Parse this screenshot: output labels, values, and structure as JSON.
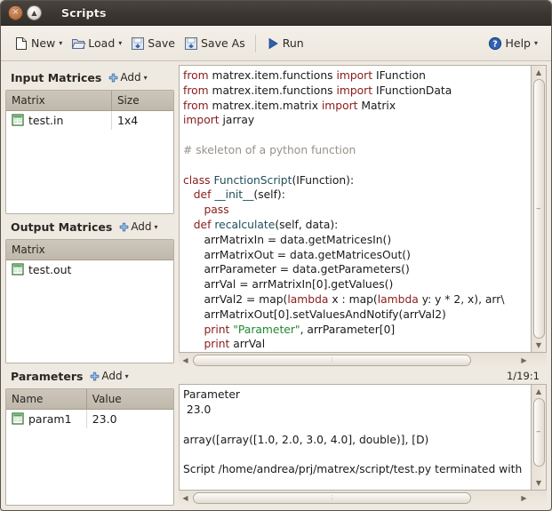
{
  "window": {
    "title": "Scripts",
    "close_label": "✕",
    "shade_label": "▲"
  },
  "toolbar": {
    "new_label": "New",
    "load_label": "Load",
    "save_label": "Save",
    "save_as_label": "Save As",
    "run_label": "Run",
    "help_label": "Help",
    "caret": "▾"
  },
  "sidebar": {
    "input_matrices": {
      "title": "Input Matrices",
      "add_label": "Add",
      "columns": [
        "Matrix",
        "Size"
      ],
      "rows": [
        {
          "matrix": "test.in",
          "size": "1x4"
        }
      ]
    },
    "output_matrices": {
      "title": "Output Matrices",
      "add_label": "Add",
      "columns": [
        "Matrix"
      ],
      "rows": [
        {
          "matrix": "test.out"
        }
      ]
    },
    "parameters": {
      "title": "Parameters",
      "add_label": "Add",
      "columns": [
        "Name",
        "Value"
      ],
      "rows": [
        {
          "name": "param1",
          "value": "23.0"
        }
      ]
    }
  },
  "editor": {
    "caret_position": "1/19:1",
    "lines": [
      [
        {
          "t": "from",
          "c": "k"
        },
        {
          "t": " matrex.item.functions ",
          "c": "pl"
        },
        {
          "t": "import",
          "c": "k"
        },
        {
          "t": " IFunction",
          "c": "pl"
        }
      ],
      [
        {
          "t": "from",
          "c": "k"
        },
        {
          "t": " matrex.item.functions ",
          "c": "pl"
        },
        {
          "t": "import",
          "c": "k"
        },
        {
          "t": " IFunctionData",
          "c": "pl"
        }
      ],
      [
        {
          "t": "from",
          "c": "k"
        },
        {
          "t": " matrex.item.matrix ",
          "c": "pl"
        },
        {
          "t": "import",
          "c": "k"
        },
        {
          "t": " Matrix",
          "c": "pl"
        }
      ],
      [
        {
          "t": "import",
          "c": "k"
        },
        {
          "t": " jarray",
          "c": "pl"
        }
      ],
      [],
      [
        {
          "t": "# skeleton of a python function",
          "c": "cm"
        }
      ],
      [],
      [
        {
          "t": "class",
          "c": "k"
        },
        {
          "t": " ",
          "c": "pl"
        },
        {
          "t": "FunctionScript",
          "c": "id"
        },
        {
          "t": "(IFunction):",
          "c": "pl"
        }
      ],
      [
        {
          "t": "   ",
          "c": "pl"
        },
        {
          "t": "def",
          "c": "k"
        },
        {
          "t": " ",
          "c": "pl"
        },
        {
          "t": "__init__",
          "c": "id"
        },
        {
          "t": "(self):",
          "c": "pl"
        }
      ],
      [
        {
          "t": "      ",
          "c": "pl"
        },
        {
          "t": "pass",
          "c": "k"
        }
      ],
      [
        {
          "t": "   ",
          "c": "pl"
        },
        {
          "t": "def",
          "c": "k"
        },
        {
          "t": " ",
          "c": "pl"
        },
        {
          "t": "recalculate",
          "c": "id"
        },
        {
          "t": "(self, data):",
          "c": "pl"
        }
      ],
      [
        {
          "t": "      arrMatrixIn = data.getMatricesIn()",
          "c": "pl"
        }
      ],
      [
        {
          "t": "      arrMatrixOut = data.getMatricesOut()",
          "c": "pl"
        }
      ],
      [
        {
          "t": "      arrParameter = data.getParameters()",
          "c": "pl"
        }
      ],
      [
        {
          "t": "      arrVal = arrMatrixIn[0].getValues()",
          "c": "pl"
        }
      ],
      [
        {
          "t": "      arrVal2 = map(",
          "c": "pl"
        },
        {
          "t": "lambda",
          "c": "k"
        },
        {
          "t": " x : map(",
          "c": "pl"
        },
        {
          "t": "lambda",
          "c": "k"
        },
        {
          "t": " y: y * 2, x), arr\\",
          "c": "pl"
        }
      ],
      [
        {
          "t": "      arrMatrixOut[0].setValuesAndNotify(arrVal2)",
          "c": "pl"
        }
      ],
      [
        {
          "t": "      ",
          "c": "pl"
        },
        {
          "t": "print",
          "c": "k"
        },
        {
          "t": " ",
          "c": "pl"
        },
        {
          "t": "\"Parameter\"",
          "c": "str"
        },
        {
          "t": ", arrParameter[0]",
          "c": "pl"
        }
      ],
      [
        {
          "t": "      ",
          "c": "pl"
        },
        {
          "t": "print",
          "c": "k"
        },
        {
          "t": " arrVal",
          "c": "pl"
        }
      ]
    ]
  },
  "console": {
    "lines": [
      "Parameter",
      " 23.0",
      "",
      "array([array([1.0, 2.0, 3.0, 4.0], double)], [D)",
      "",
      "Script /home/andrea/prj/matrex/script/test.py terminated with"
    ]
  },
  "colors": {
    "keyword": "#8b1a1a",
    "identifier": "#1f4f5a",
    "comment": "#999089",
    "string": "#1f8a2e",
    "accent_blue": "#3465a4",
    "matrix_icon_green": "#3a8c3a"
  }
}
